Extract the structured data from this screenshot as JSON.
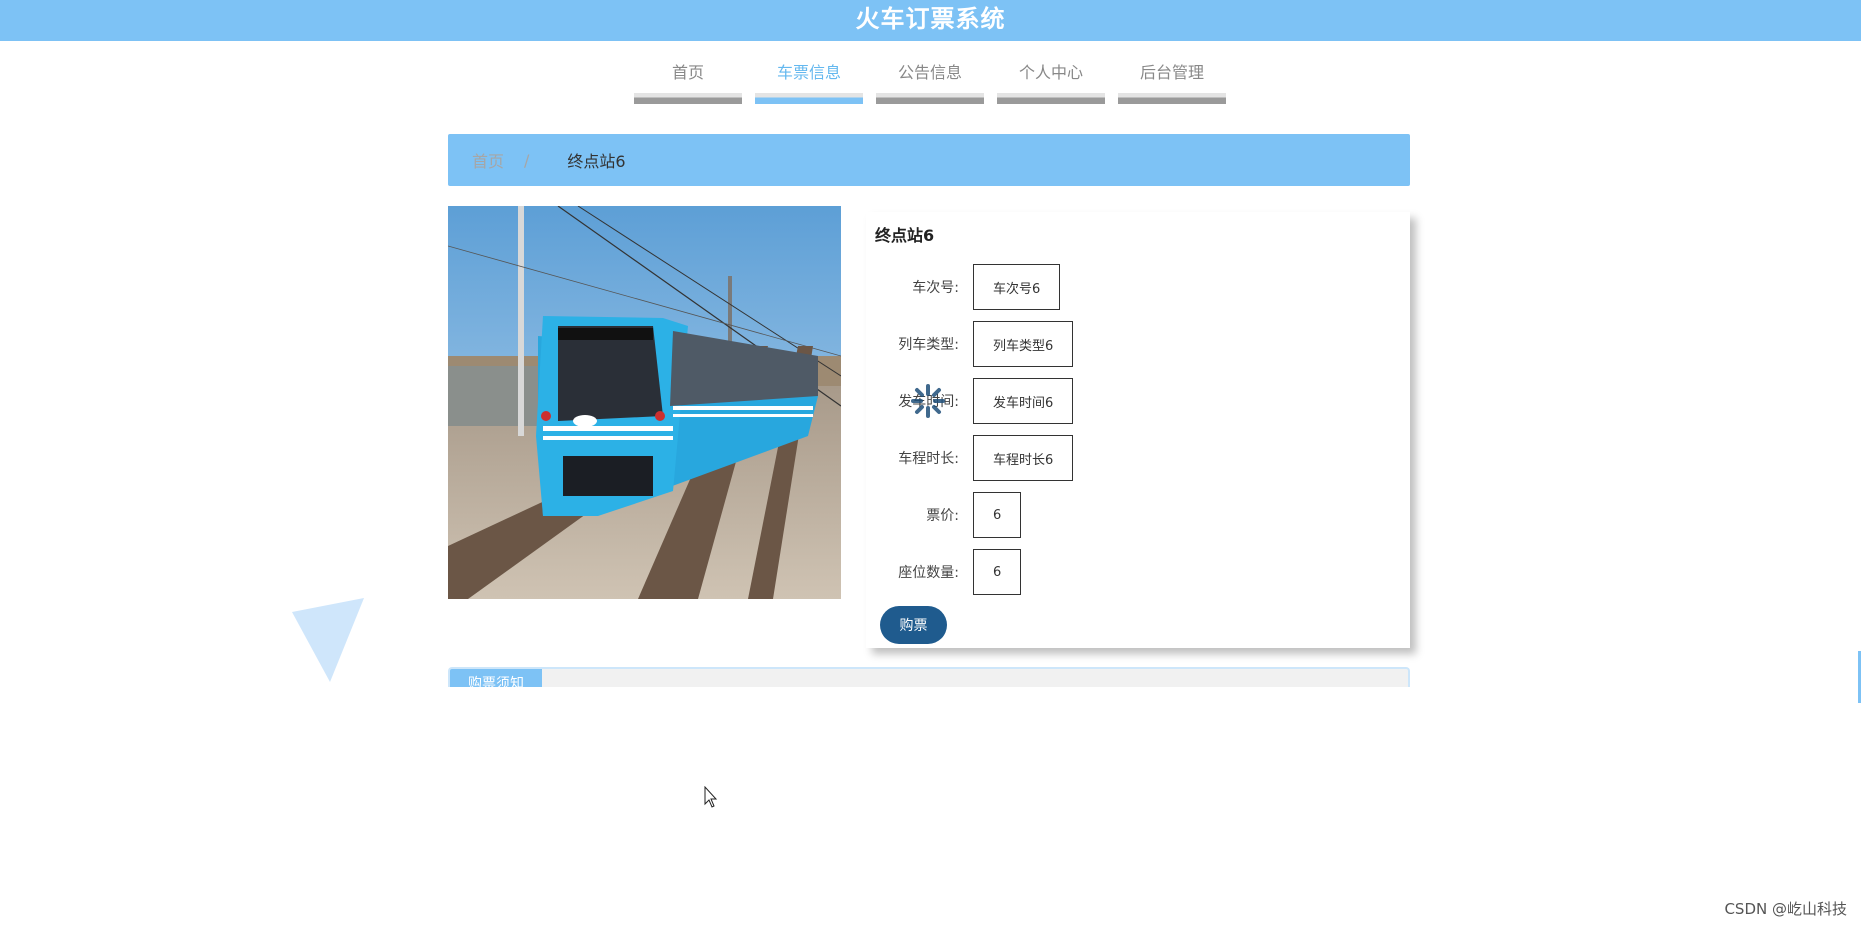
{
  "header": {
    "title": "火车订票系统"
  },
  "nav": {
    "items": [
      {
        "label": "首页",
        "active": false
      },
      {
        "label": "车票信息",
        "active": true
      },
      {
        "label": "公告信息",
        "active": false
      },
      {
        "label": "个人中心",
        "active": false
      },
      {
        "label": "后台管理",
        "active": false
      }
    ]
  },
  "breadcrumb": {
    "home": "首页",
    "separator": "/",
    "current": "终点站6"
  },
  "detail": {
    "title": "终点站6",
    "fields": [
      {
        "label": "车次号:",
        "value": "车次号6"
      },
      {
        "label": "列车类型:",
        "value": "列车类型6"
      },
      {
        "label": "发车时间:",
        "value": "发车时间6"
      },
      {
        "label": "车程时长:",
        "value": "车程时长6"
      },
      {
        "label": "票价:",
        "value": "6"
      },
      {
        "label": "座位数量:",
        "value": "6"
      }
    ],
    "buy_label": "购票"
  },
  "notice": {
    "tab_label": "购票须知"
  },
  "watermark": "CSDN @屹山科技",
  "colors": {
    "accent": "#7dc2f5",
    "button": "#1f5b8e",
    "active_nav": "#64b8ef"
  },
  "icons": {
    "loading": "spinner-icon",
    "pointer": "cursor-icon",
    "decoration": "triangle-decoration"
  }
}
